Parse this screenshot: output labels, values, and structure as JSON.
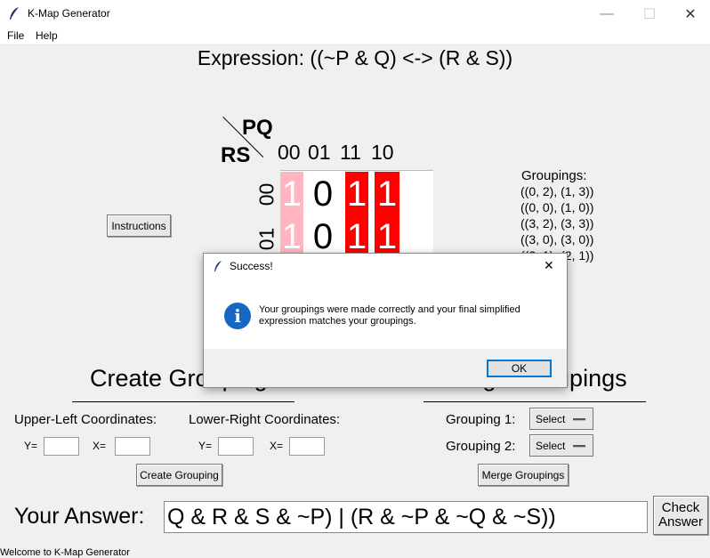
{
  "window": {
    "title": "K-Map Generator",
    "controls": {
      "minimize": "—",
      "maximize": "☐",
      "close": "✕"
    }
  },
  "menu": [
    "File",
    "Help"
  ],
  "expression": "Expression: ((~P & Q) <-> (R & S))",
  "kmap": {
    "col_var": "PQ",
    "row_var": "RS",
    "col_headers": [
      "00",
      "01",
      "11",
      "10"
    ],
    "row_headers": [
      "00",
      "01"
    ],
    "rows": [
      [
        "1",
        "0",
        "1",
        "1"
      ],
      [
        "1",
        "0",
        "1",
        "1"
      ]
    ],
    "highlight_colors": {
      "pink": "#ffb6c1",
      "red": "#ff0000"
    }
  },
  "instructions_button": "Instructions",
  "groupings": {
    "title": "Groupings:",
    "items": [
      "((0, 2), (1, 3))",
      "((0, 0), (1, 0))",
      "((3, 2), (3, 3))",
      "((3, 0), (3, 0))",
      "((2, 1), (2, 1))"
    ]
  },
  "create": {
    "title": "Create Grouping",
    "upper_left": "Upper-Left Coordinates:",
    "lower_right": "Lower-Right Coordinates:",
    "y": "Y=",
    "x": "X=",
    "button": "Create Grouping"
  },
  "merge": {
    "title": "Merge Groupings",
    "grouping1": "Grouping 1:",
    "grouping2": "Grouping 2:",
    "select1": "Select",
    "select2": "Select",
    "button": "Merge Groupings"
  },
  "answer": {
    "label": "Your Answer:",
    "value": "Q & R & S & ~P) | (R & ~P & ~Q & ~S))",
    "check": "Check Answer"
  },
  "status": "Welcome to K-Map Generator",
  "dialog": {
    "title": "Success!",
    "close": "✕",
    "icon": "i",
    "message": "Your groupings were made correctly and your final simplified expression matches your groupings.",
    "ok": "OK"
  }
}
